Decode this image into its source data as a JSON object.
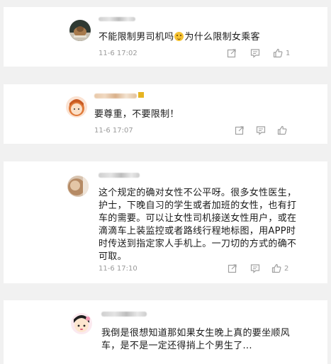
{
  "comments": [
    {
      "text_before": "不能限制男司机吗",
      "emoji": "smiley-emoji",
      "text_after": "为什么限制女乘客",
      "time": "11-6 17:02",
      "likes": "1"
    },
    {
      "text": "要尊重，不要限制！",
      "time": "11-6 17:07",
      "likes": ""
    },
    {
      "text": "这个规定的确对女性不公平呀。很多女性医生，\n护士，下晚自习的学生或者加班的女性，也有打\n车的需要。可以让女性司机接送女性用户，或在\n滴滴车上装监控或者路线行程地标图，用APP时\n时传送到指定家人手机上。一刀切的方式的确不\n可取。",
      "time": "11-6 17:10",
      "likes": "2"
    },
    {
      "text": "我倒是很想知道那如果女生晚上真的要坐顺风\n车，是不是一定还得捎上个男生了...",
      "time": "",
      "likes": ""
    }
  ],
  "icons": {
    "share": "share-icon",
    "reply": "comment-icon",
    "like": "thumbs-up-icon"
  },
  "colors": {
    "background": "#f1f1f1",
    "card": "#ffffff",
    "text": "#1a1a1a",
    "meta": "#9a9a9a",
    "icon": "#a0a0a0"
  }
}
